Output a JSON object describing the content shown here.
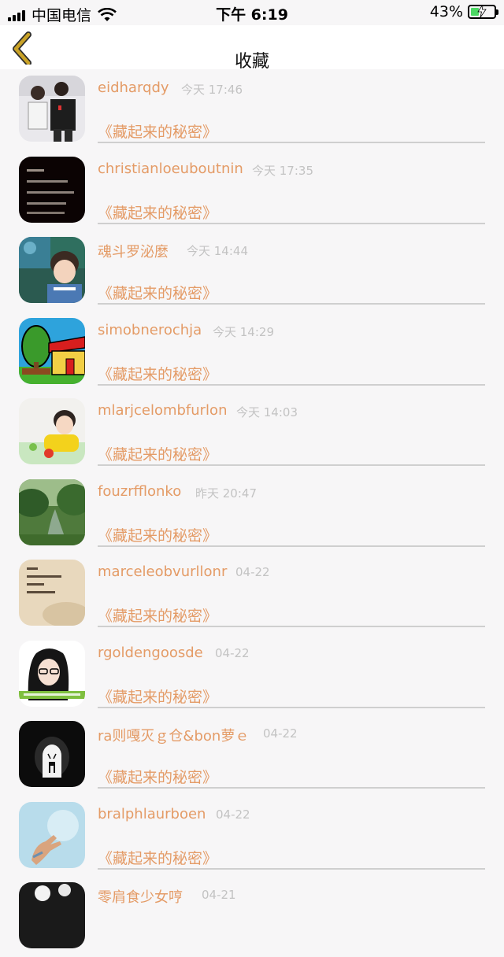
{
  "status_bar": {
    "carrier": "中国电信",
    "time": "下午 6:19",
    "battery_percent": "43%",
    "battery_level": 0.43
  },
  "nav": {
    "title": "收藏"
  },
  "colors": {
    "accent": "#e49b66",
    "timestamp": "#c3c3c3",
    "background": "#f7f6f7",
    "back_chevron": "#c9a227"
  },
  "items": [
    {
      "name": "eidharqdy",
      "time": "今天 17:46",
      "title": "《藏起来的秘密》"
    },
    {
      "name": "christianloeuboutnin",
      "time": "今天 17:35",
      "title": "《藏起来的秘密》"
    },
    {
      "name": "魂斗罗泌麼",
      "time": "今天 14:44",
      "title": "《藏起来的秘密》"
    },
    {
      "name": "simobnerochja",
      "time": "今天 14:29",
      "title": "《藏起来的秘密》"
    },
    {
      "name": "mlarjcelombfurlon",
      "time": "今天 14:03",
      "title": "《藏起来的秘密》"
    },
    {
      "name": "fouzrfflonko",
      "time": "昨天 20:47",
      "title": "《藏起来的秘密》"
    },
    {
      "name": "marceleobvurllonr",
      "time": "04-22",
      "title": "《藏起来的秘密》"
    },
    {
      "name": "rgoldengoosde",
      "time": "04-22",
      "title": "《藏起来的秘密》"
    },
    {
      "name": "ra则嘎灭ｇ仓&bon萝ｅ",
      "time": "04-22",
      "title": "《藏起来的秘密》"
    },
    {
      "name": "bralphlaurboen",
      "time": "04-22",
      "title": "《藏起来的秘密》"
    },
    {
      "name": "零肩食少女哼",
      "time": "04-21",
      "title": ""
    }
  ]
}
